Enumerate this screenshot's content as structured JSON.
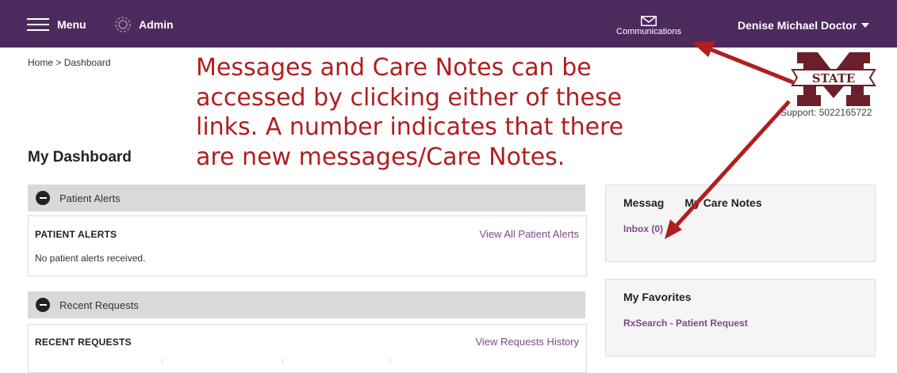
{
  "topbar": {
    "menu_label": "Menu",
    "admin_label": "Admin",
    "communications_label": "Communications",
    "user_name": "Denise Michael Doctor",
    "background": "#4d2a5e"
  },
  "breadcrumb": {
    "home": "Home",
    "separator": ">",
    "current": "Dashboard"
  },
  "page_title": "My Dashboard",
  "annotation": {
    "lines": [
      "Messages and Care Notes can be",
      "accessed by clicking either of these",
      "links. A number indicates that there",
      "are new messages/Care Notes."
    ],
    "color": "#b11e1e"
  },
  "patient_alerts": {
    "section_label": "Patient Alerts",
    "title": "PATIENT ALERTS",
    "link": "View All Patient Alerts",
    "empty_text": "No patient alerts received."
  },
  "recent_requests": {
    "section_label": "Recent Requests",
    "title": "RECENT REQUESTS",
    "link": "View Requests History"
  },
  "messages_panel": {
    "title": "Messages/My Care Notes",
    "title_visible": "Messag",
    "title_visible_end": "My Care Notes",
    "inbox_link": "Inbox (0)"
  },
  "favorites_panel": {
    "title": "My Favorites",
    "link": "RxSearch - Patient Request"
  },
  "logo": {
    "text": "STATE",
    "color": "#6b1f2a"
  },
  "support": {
    "label": "Support:",
    "phone": "5022165722"
  },
  "icons": [
    "hamburger-menu-icon",
    "gear-icon",
    "envelope-icon",
    "caret-down-icon",
    "minus-circle-icon"
  ],
  "link_color": "#7c4a87"
}
